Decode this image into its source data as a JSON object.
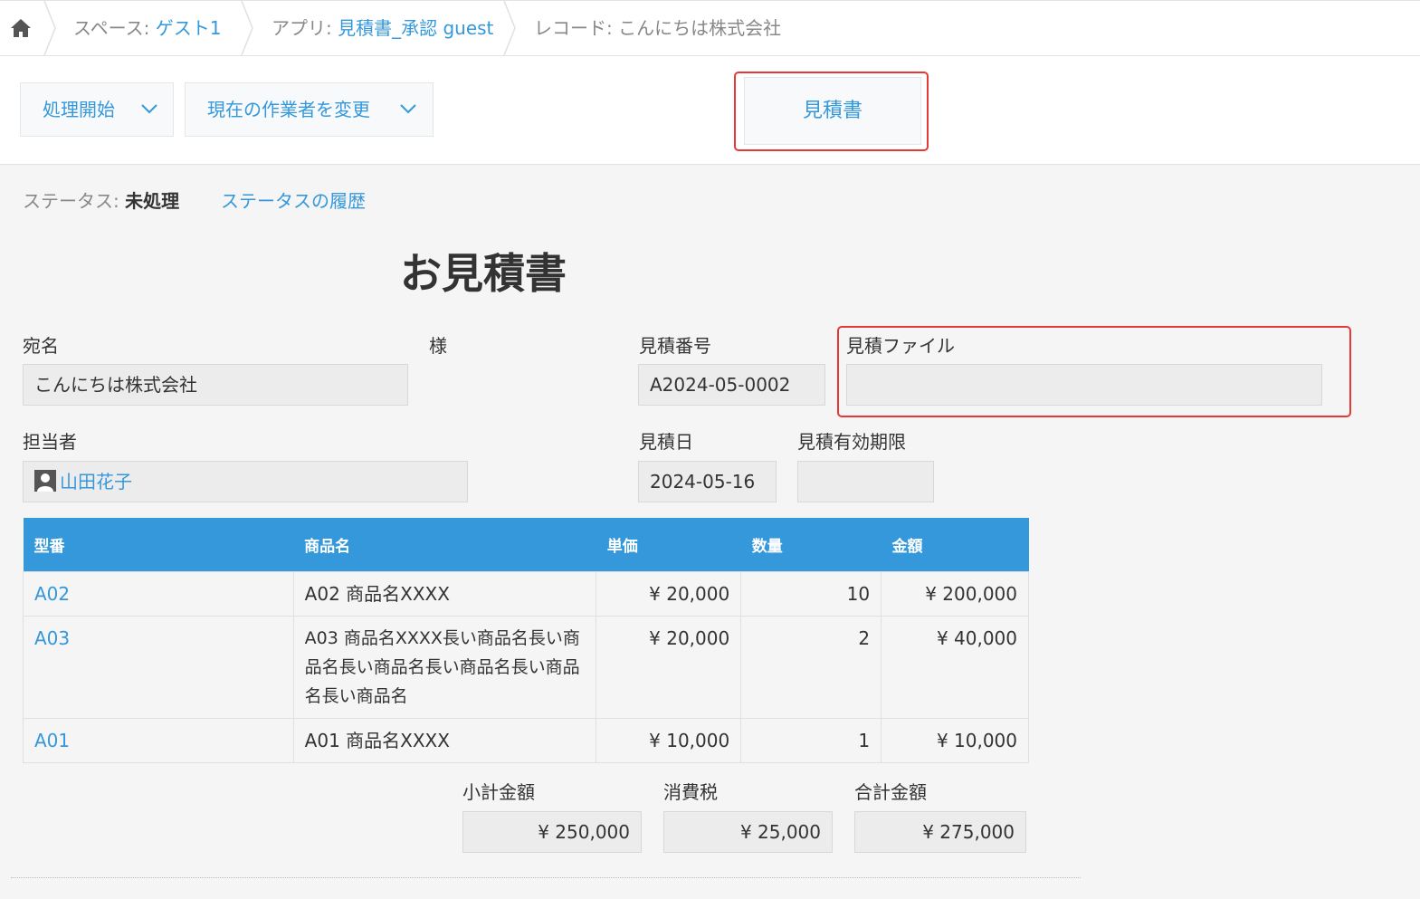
{
  "breadcrumb": {
    "home_icon": "home-icon",
    "space_prefix": "スペース: ",
    "space_name": "ゲスト1",
    "app_prefix": "アプリ: ",
    "app_name": "見積書_承認 guest",
    "record_prefix": "レコード: ",
    "record_name": "こんにちは株式会社"
  },
  "toolbar": {
    "start_process": "処理開始",
    "change_assignee": "現在の作業者を変更",
    "estimate_button": "見積書"
  },
  "status": {
    "prefix": "ステータス: ",
    "value": "未処理",
    "history_link": "ステータスの履歴"
  },
  "form": {
    "title": "お見積書",
    "addressee_label": "宛名",
    "addressee_value": "こんにちは株式会社",
    "honorific": "様",
    "quote_no_label": "見積番号",
    "quote_no_value": "A2024-05-0002",
    "quote_file_label": "見積ファイル",
    "quote_file_value": "",
    "person_label": "担当者",
    "person_value": "山田花子",
    "date_label": "見積日",
    "date_value": "2024-05-16",
    "valid_label": "見積有効期限",
    "valid_value": ""
  },
  "table": {
    "headers": [
      "型番",
      "商品名",
      "単価",
      "数量",
      "金額"
    ],
    "rows": [
      {
        "code": "A02",
        "name": "A02 商品名XXXX",
        "price": "¥ 20,000",
        "qty": "10",
        "amount": "¥ 200,000"
      },
      {
        "code": "A03",
        "name": "A03 商品名XXXX長い商品名長い商品名長い商品名長い商品名長い商品名長い商品名",
        "price": "¥ 20,000",
        "qty": "2",
        "amount": "¥ 40,000"
      },
      {
        "code": "A01",
        "name": "A01 商品名XXXX",
        "price": "¥ 10,000",
        "qty": "1",
        "amount": "¥ 10,000"
      }
    ]
  },
  "totals": {
    "subtotal_label": "小計金額",
    "subtotal_value": "¥ 250,000",
    "tax_label": "消費税",
    "tax_value": "¥ 25,000",
    "total_label": "合計金額",
    "total_value": "¥ 275,000"
  },
  "colors": {
    "accent": "#3498db",
    "highlight": "#e53935"
  }
}
